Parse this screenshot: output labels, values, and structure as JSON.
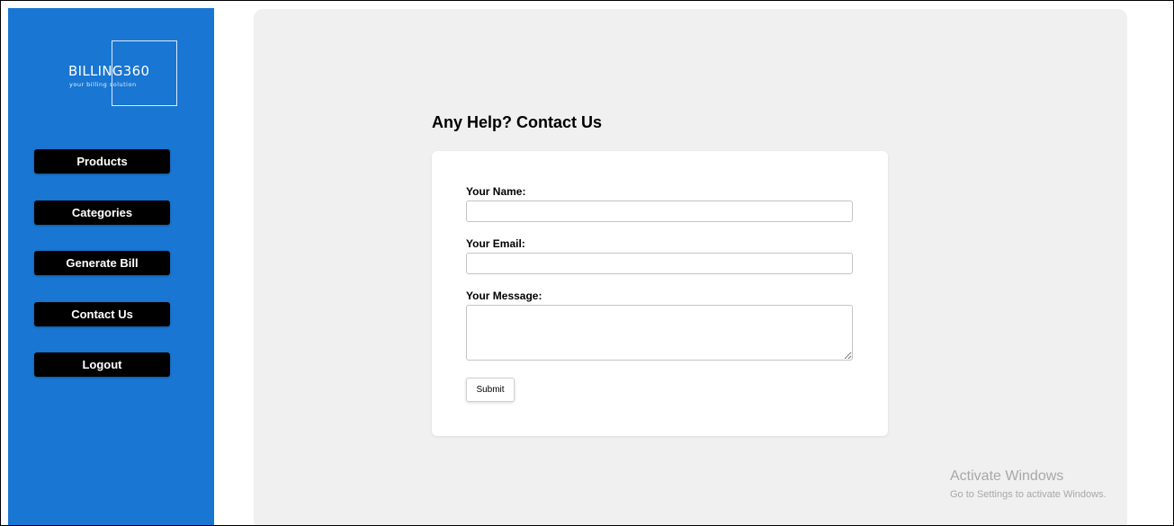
{
  "brand": {
    "title": "BILLING360",
    "tagline": "your billing solution"
  },
  "sidebar": {
    "items": [
      {
        "label": "Products"
      },
      {
        "label": "Categories"
      },
      {
        "label": "Generate Bill"
      },
      {
        "label": "Contact Us"
      },
      {
        "label": "Logout"
      }
    ]
  },
  "main": {
    "heading": "Any Help? Contact Us",
    "form": {
      "name_label": "Your Name:",
      "name_value": "",
      "email_label": "Your Email:",
      "email_value": "",
      "message_label": "Your Message:",
      "message_value": "",
      "submit_label": "Submit"
    }
  },
  "watermark": {
    "title": "Activate Windows",
    "subtitle": "Go to Settings to activate Windows."
  },
  "colors": {
    "sidebar_bg": "#1976d2",
    "main_bg": "#f0f0f0",
    "nav_button_bg": "#000000"
  }
}
